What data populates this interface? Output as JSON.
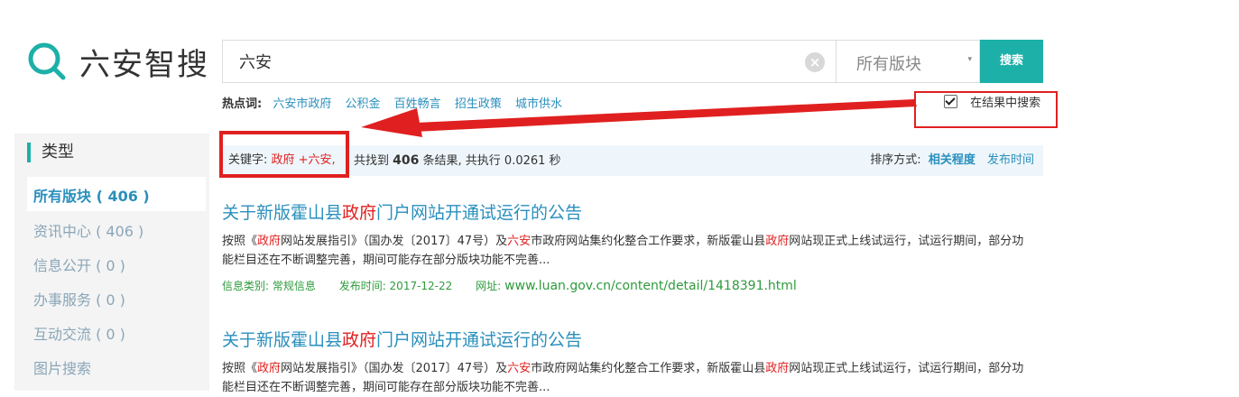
{
  "logo": {
    "text": "六安智搜",
    "icon": "search-magnifier-logo-icon"
  },
  "search": {
    "query": "六安",
    "clear_icon": "×",
    "scope_selected": "所有版块",
    "scope_caret": "▾",
    "button_label": "搜索"
  },
  "hot_words": {
    "label": "热点词:",
    "items": [
      "六安市政府",
      "公积金",
      "百姓畅言",
      "招生政策",
      "城市供水"
    ]
  },
  "search_within": {
    "label": "在结果中搜索",
    "checked": true
  },
  "sidebar": {
    "title": "类型",
    "items": [
      {
        "label": "所有版块 ( 406 )",
        "active": true
      },
      {
        "label": "资讯中心 ( 406 )",
        "active": false
      },
      {
        "label": "信息公开 ( 0 )",
        "active": false
      },
      {
        "label": "办事服务 ( 0 )",
        "active": false
      },
      {
        "label": "互动交流 ( 0 )",
        "active": false
      },
      {
        "label": "图片搜索",
        "active": false
      }
    ]
  },
  "results_info": {
    "keyword_label": "关键字:",
    "keyword_terms": "政府 +六安,",
    "found_prefix": "共找到",
    "count": "406",
    "found_suffix": "条结果,  共执行 0.0261 秒",
    "sort_label": "排序方式:",
    "sort_relevance": "相关程度",
    "sort_time": "发布时间"
  },
  "results": [
    {
      "title_pre": "关于新版霍山县",
      "title_hl": "政府",
      "title_post": "门户网站开通试运行的公告",
      "snippet": [
        {
          "t": "按照《",
          "h": false
        },
        {
          "t": "政府",
          "h": true
        },
        {
          "t": "网站发展指引》（国办发〔2017〕47号）及",
          "h": false
        },
        {
          "t": "六安",
          "h": true
        },
        {
          "t": "市政府网站集约化整合工作要求，新版霍山县",
          "h": false
        },
        {
          "t": "政府",
          "h": true
        },
        {
          "t": "网站现正式上线试运行，试运行期间，部分功能栏目还在不断调整完善，期间可能存在部分版块功能不完善...",
          "h": false
        }
      ],
      "category": "信息类别: 常规信息",
      "date": "发布时间: 2017-12-22",
      "url_label": "网址:",
      "url": "www.luan.gov.cn/content/detail/1418391.html"
    },
    {
      "title_pre": "关于新版霍山县",
      "title_hl": "政府",
      "title_post": "门户网站开通试运行的公告",
      "snippet": [
        {
          "t": "按照《",
          "h": false
        },
        {
          "t": "政府",
          "h": true
        },
        {
          "t": "网站发展指引》（国办发〔2017〕47号）及",
          "h": false
        },
        {
          "t": "六安",
          "h": true
        },
        {
          "t": "市政府网站集约化整合工作要求，新版霍山县",
          "h": false
        },
        {
          "t": "政府",
          "h": true
        },
        {
          "t": "网站现正式上线试运行，试运行期间，部分功能栏目还在不断调整完善，期间可能存在部分版块功能不完善...",
          "h": false
        }
      ]
    }
  ],
  "colors": {
    "accent": "#1cb0a8",
    "link": "#2a8fbd",
    "highlight": "#e02020",
    "meta_green": "#2e9b3c",
    "annotation_red": "#e02020"
  }
}
